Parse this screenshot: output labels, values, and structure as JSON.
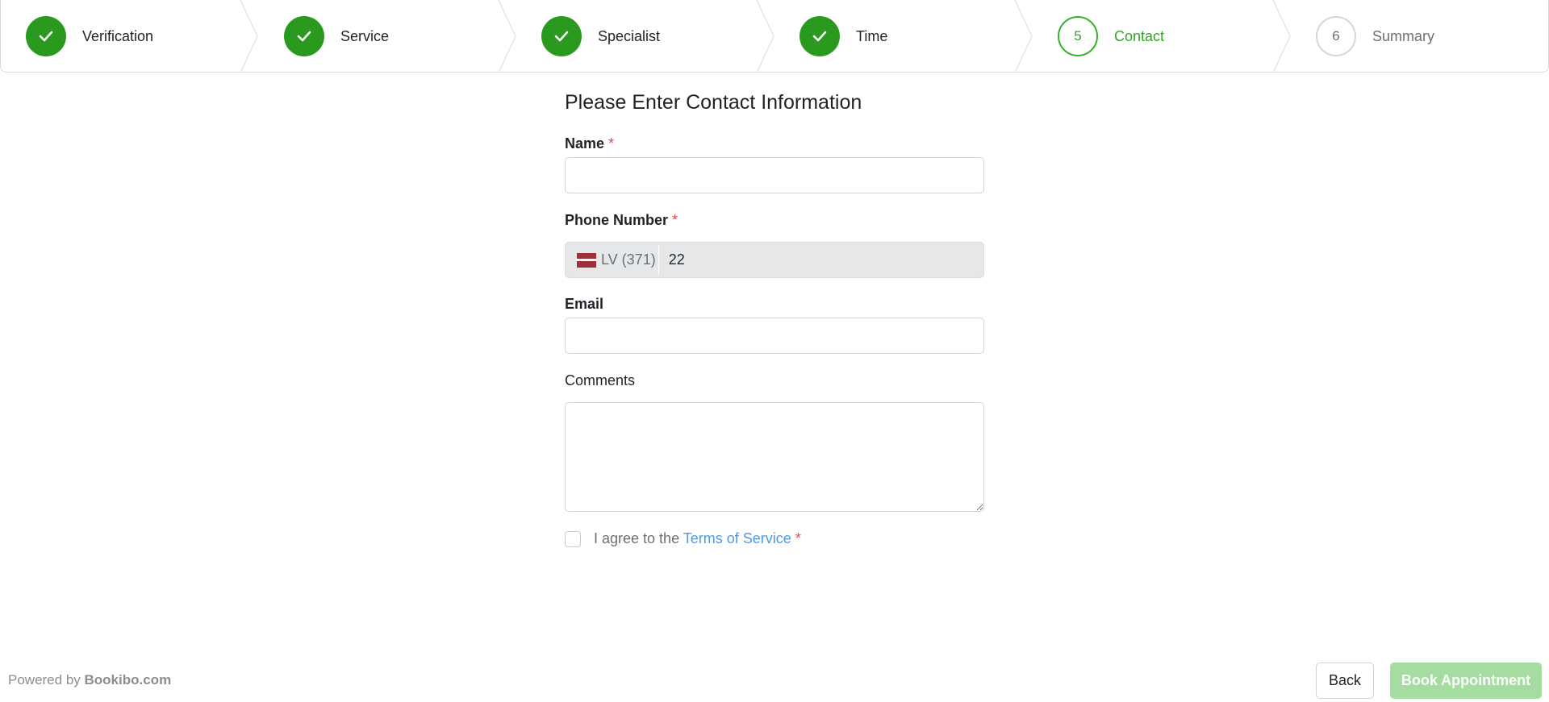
{
  "stepper": {
    "steps": [
      {
        "label": "Verification",
        "state": "done",
        "number": ""
      },
      {
        "label": "Service",
        "state": "done",
        "number": ""
      },
      {
        "label": "Specialist",
        "state": "done",
        "number": ""
      },
      {
        "label": "Time",
        "state": "done",
        "number": ""
      },
      {
        "label": "Contact",
        "state": "active",
        "number": "5"
      },
      {
        "label": "Summary",
        "state": "pending",
        "number": "6"
      }
    ],
    "done_icon": "checkmark-icon"
  },
  "form": {
    "title": "Please Enter Contact Information",
    "required_mark": "*",
    "name": {
      "label": "Name",
      "value": ""
    },
    "phone": {
      "label": "Phone Number",
      "country_code": "LV (371)",
      "country_flag": "latvia-flag-icon",
      "value": "22"
    },
    "email": {
      "label": "Email",
      "value": ""
    },
    "comments": {
      "label": "Comments",
      "value": ""
    },
    "agree": {
      "text": "I agree to the",
      "link": "Terms of Service",
      "checked": false
    }
  },
  "footer": {
    "powered_prefix": "Powered by",
    "powered_brand": "Bookibo.com",
    "back_label": "Back",
    "book_label": "Book Appointment"
  },
  "colors": {
    "success": "#2a9a1f",
    "active": "#2ea725",
    "link": "#4d98e6",
    "required": "#e5484d",
    "book_disabled": "#a5dca0"
  }
}
